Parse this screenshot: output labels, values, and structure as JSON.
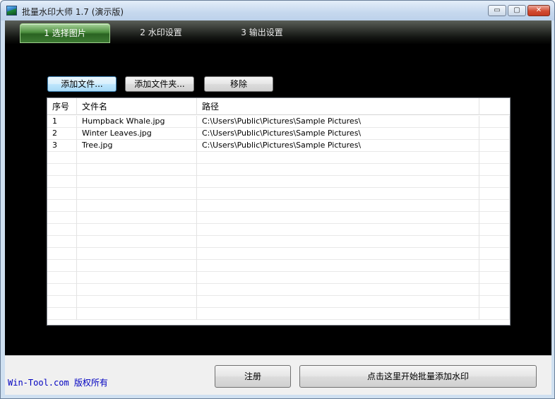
{
  "window": {
    "title": "批量水印大师 1.7 (演示版)",
    "controls": {
      "minimize": "▭",
      "maximize": "▢",
      "close": "✕"
    }
  },
  "tabs": [
    {
      "label": "1 选择图片",
      "active": true
    },
    {
      "label": "2 水印设置",
      "active": false
    },
    {
      "label": "3 输出设置",
      "active": false
    }
  ],
  "toolbar": {
    "add_file": "添加文件...",
    "add_folder": "添加文件夹...",
    "remove": "移除"
  },
  "table": {
    "headers": [
      "序号",
      "文件名",
      "路径",
      ""
    ],
    "rows": [
      [
        "1",
        "Humpback Whale.jpg",
        "C:\\Users\\Public\\Pictures\\Sample Pictures\\"
      ],
      [
        "2",
        "Winter Leaves.jpg",
        "C:\\Users\\Public\\Pictures\\Sample Pictures\\"
      ],
      [
        "3",
        "Tree.jpg",
        "C:\\Users\\Public\\Pictures\\Sample Pictures\\"
      ]
    ]
  },
  "footer": {
    "copyright": "Win-Tool.com 版权所有",
    "register": "注册",
    "start": "点击这里开始批量添加水印"
  },
  "colors": {
    "client_bg": "#000000",
    "active_tab": "#4d8f3f",
    "copyright_text": "#0000c0"
  }
}
